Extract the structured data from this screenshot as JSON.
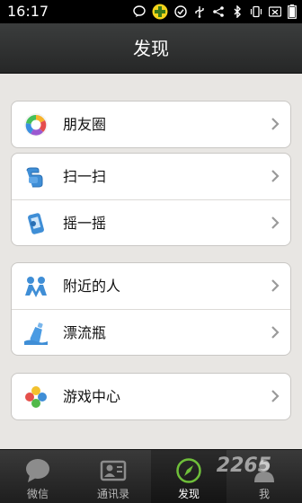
{
  "status_bar": {
    "time": "16:17",
    "icons": [
      "chat-bubble-icon",
      "plus-app-icon",
      "check-circle-icon",
      "usb-icon",
      "share-icon",
      "bluetooth-icon",
      "vibrate-icon",
      "wifi-off-icon",
      "battery-icon"
    ]
  },
  "header": {
    "title": "发现"
  },
  "groups": [
    {
      "items": [
        {
          "label": "朋友圈",
          "icon": "moments-icon"
        }
      ]
    },
    {
      "items": [
        {
          "label": "扫一扫",
          "icon": "scan-icon"
        },
        {
          "label": "摇一摇",
          "icon": "shake-icon"
        }
      ]
    },
    {
      "items": [
        {
          "label": "附近的人",
          "icon": "nearby-people-icon"
        },
        {
          "label": "漂流瓶",
          "icon": "drift-bottle-icon"
        }
      ]
    },
    {
      "items": [
        {
          "label": "游戏中心",
          "icon": "game-center-icon"
        }
      ]
    }
  ],
  "tabbar": {
    "tabs": [
      {
        "label": "微信",
        "icon": "chat-bubble-icon",
        "active": false
      },
      {
        "label": "通讯录",
        "icon": "contacts-icon",
        "active": false
      },
      {
        "label": "发现",
        "icon": "compass-icon",
        "active": true
      },
      {
        "label": "我",
        "icon": "person-icon",
        "active": false
      }
    ]
  },
  "watermark": "2265",
  "colors": {
    "background": "#e8e6e3",
    "titlebar": "#2f3030",
    "accent_green": "#6fbf3a"
  }
}
